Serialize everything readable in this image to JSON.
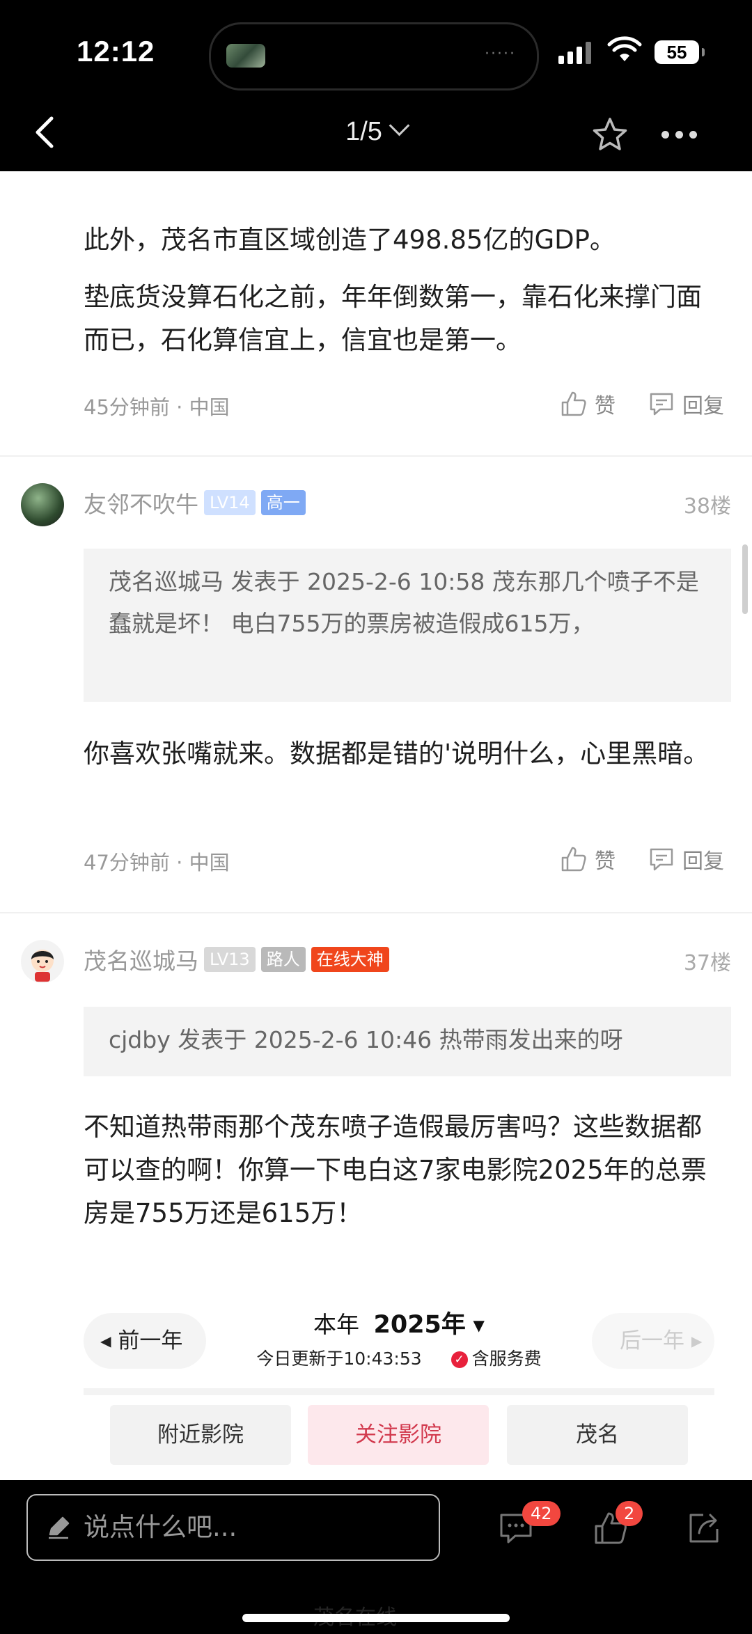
{
  "status_bar": {
    "time": "12:12",
    "battery": "55"
  },
  "nav": {
    "page_indicator": "1/5"
  },
  "comments": [
    {
      "paragraphs": [
        "此外，茂名市直区域创造了498.85亿的GDP。",
        "垫底货没算石化之前，年年倒数第一，靠石化来撑门面而已，石化算信宜上，信宜也是第一。"
      ],
      "time": "45分钟前",
      "location": "中国",
      "like_label": "赞",
      "reply_label": "回复"
    },
    {
      "username": "友邻不吹牛",
      "level": "LV14",
      "tag": "高一",
      "floor": "38楼",
      "quote": "茂名巡城马 发表于 2025-2-6 10:58 茂东那几个喷子不是蠢就是坏！  电白755万的票房被造假成615万，",
      "paragraphs": [
        "你喜欢张嘴就来。数据都是错的'说明什么，心里黑暗。"
      ],
      "time": "47分钟前",
      "location": "中国",
      "like_label": "赞",
      "reply_label": "回复"
    },
    {
      "username": "茂名巡城马",
      "level": "LV13",
      "tag": "路人",
      "tag2": "在线大神",
      "floor": "37楼",
      "quote": "cjdby 发表于 2025-2-6 10:46 热带雨发出来的呀",
      "paragraphs": [
        "不知道热带雨那个茂东喷子造假最厉害吗？这些数据都可以查的啊！你算一下电白这7家电影院2025年的总票房是755万还是615万！"
      ]
    }
  ],
  "embed": {
    "prev": "前一年",
    "next": "后一年",
    "year_label": "本年",
    "year": "2025年",
    "year_arrow": "▾",
    "updated": "今日更新于10:43:53",
    "fee": "含服务费",
    "tabs": [
      "附近影院",
      "关注影院",
      "茂名"
    ]
  },
  "bottom": {
    "input_placeholder": "说点什么吧...",
    "comment_count": "42",
    "like_count": "2",
    "watermark": "茂名在线"
  },
  "colors": {
    "accent_red": "#f2473f",
    "tag_red": "#f0461c",
    "tag_blue": "#7fa9f4"
  }
}
